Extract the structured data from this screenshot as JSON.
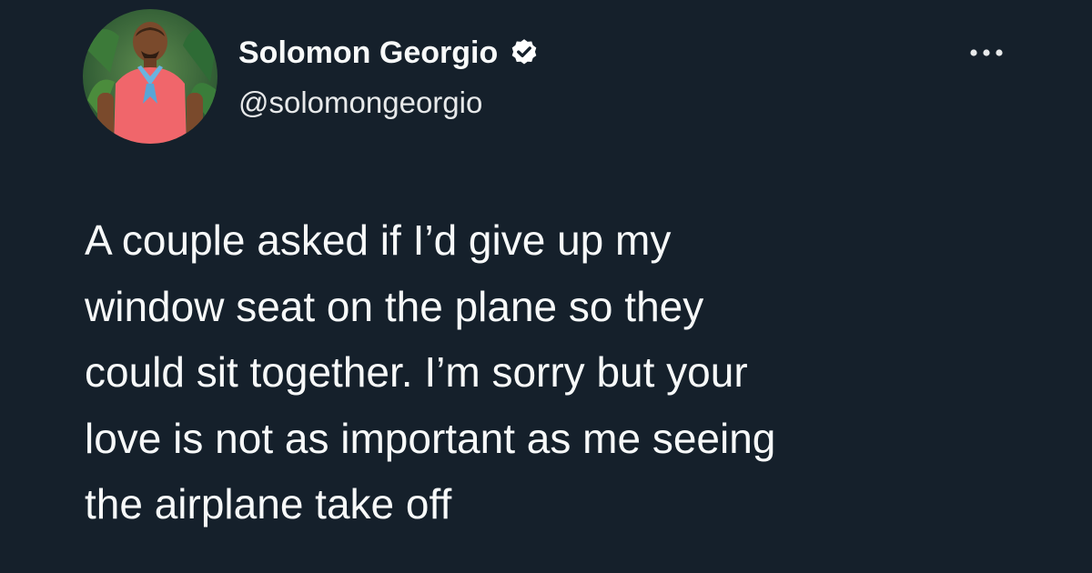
{
  "tweet": {
    "author": {
      "display_name": "Solomon Georgio",
      "handle": "@solomongeorgio",
      "verified": true,
      "avatar_icon": "profile-photo"
    },
    "more_icon": "more-dots-icon",
    "text_lines": [
      "A couple asked if I’d give up my",
      "window seat on the plane so they",
      "could sit together. I’m sorry but your",
      "love is not as important as me seeing",
      "the airplane take off"
    ]
  },
  "colors": {
    "background": "#15202b",
    "text": "#f7f9f9",
    "verified_badge": "#ffffff",
    "avatar_background": "#2f6b3f",
    "avatar_shirt": "#f0666b"
  }
}
